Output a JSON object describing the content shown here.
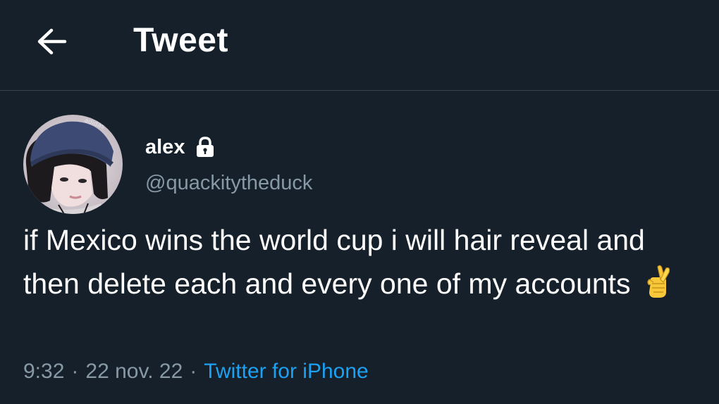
{
  "header": {
    "title": "Tweet",
    "back_icon": "arrow-left-icon"
  },
  "author": {
    "display_name": "alex",
    "handle": "@quackitytheduck",
    "protected_icon": "lock-icon",
    "avatar_beanie_text": "adidas"
  },
  "tweet": {
    "text": "if Mexico wins the world cup i will hair reveal and then delete each and every one of my accounts",
    "emoji": "crossed-fingers-icon"
  },
  "meta": {
    "time": "9:32",
    "separator": "·",
    "date": "22 nov. 22",
    "source": "Twitter for iPhone"
  },
  "colors": {
    "background": "#15202b",
    "text": "#ffffff",
    "secondary": "#8899a6",
    "link": "#1da1f2",
    "divider": "#38444d"
  }
}
